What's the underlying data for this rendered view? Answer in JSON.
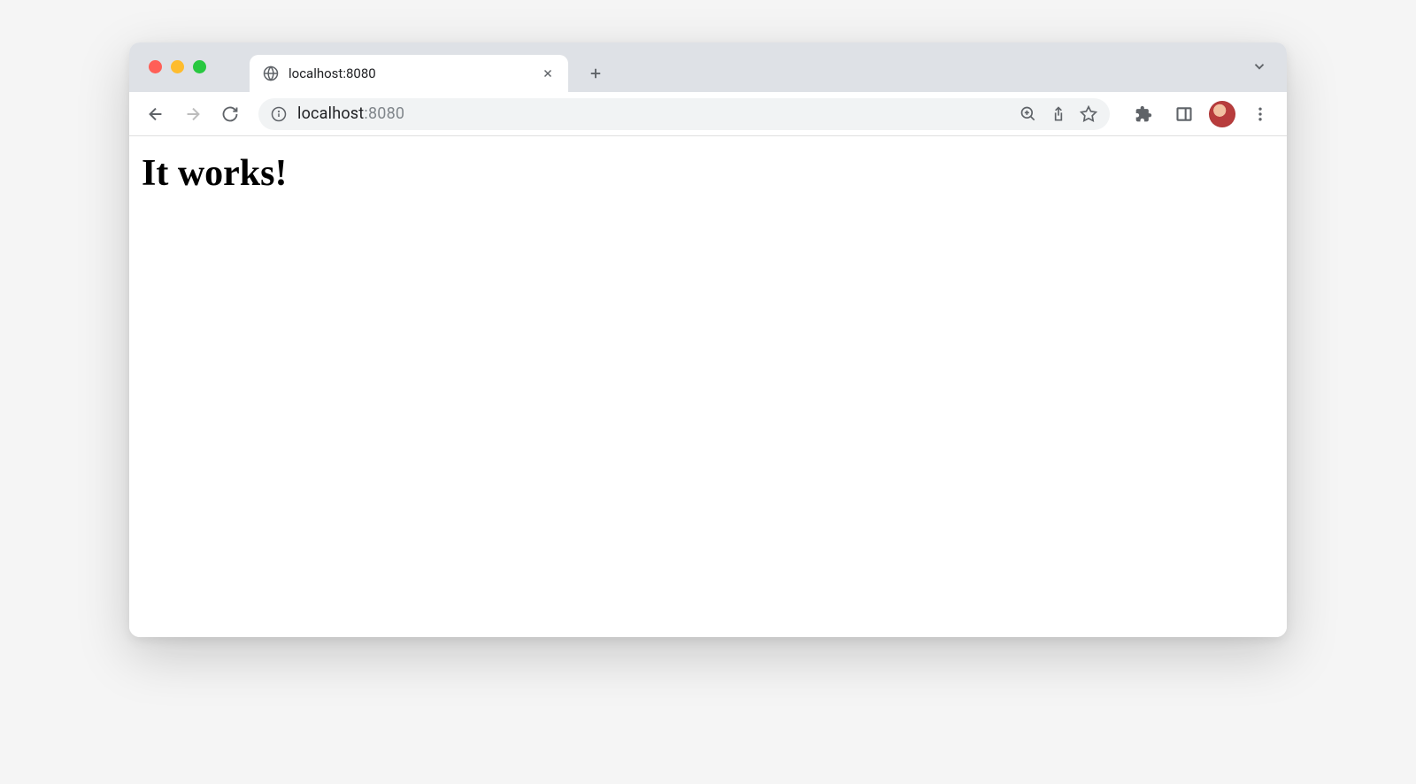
{
  "tab": {
    "title": "localhost:8080",
    "favicon": "globe-icon"
  },
  "omnibox": {
    "host": "localhost",
    "port": ":8080"
  },
  "page": {
    "heading": "It works!"
  }
}
